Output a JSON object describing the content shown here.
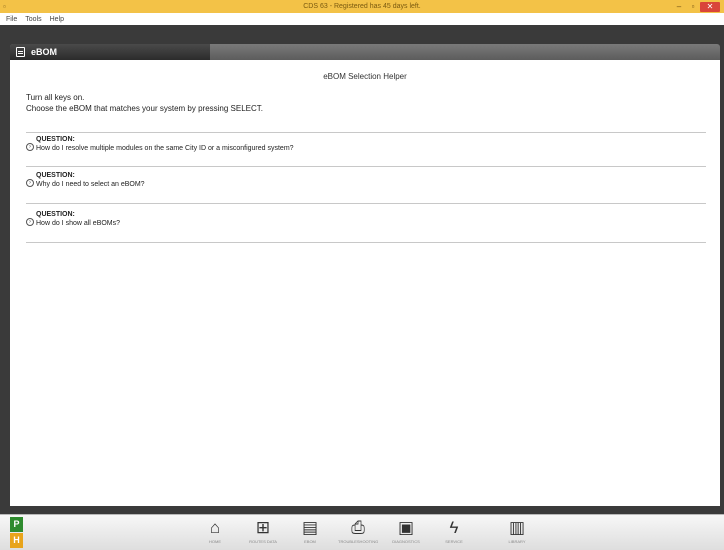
{
  "window": {
    "title": "CDS 63 - Registered has 45 days left.",
    "minimize": "–",
    "restore": "▫",
    "close": "✕"
  },
  "menu": {
    "items": [
      "File",
      "Tools",
      "Help"
    ]
  },
  "tab": {
    "label": "eBOM"
  },
  "helper": {
    "title": "eBOM Selection Helper",
    "line1": "Turn all keys on.",
    "line2": "Choose the eBOM that matches your system by pressing SELECT."
  },
  "questions": [
    {
      "label": "QUESTION:",
      "text": "How do I resolve multiple modules on the same City ID or a misconfigured system?",
      "icon": "expand-circle-icon"
    },
    {
      "label": "QUESTION:",
      "text": "Why do I need to select an eBOM?",
      "icon": "expand-circle-icon"
    },
    {
      "label": "QUESTION:",
      "text": "How do I show all eBOMs?",
      "icon": "expand-circle-icon"
    }
  ],
  "status": {
    "p": "P",
    "h": "H"
  },
  "nav": [
    {
      "label": "HOME",
      "icon": "home-icon",
      "glyph": "⌂"
    },
    {
      "label": "ROUTES DATA",
      "icon": "network-icon",
      "glyph": "⊞"
    },
    {
      "label": "EBOM",
      "icon": "document-icon",
      "glyph": "▤"
    },
    {
      "label": "TROUBLESHOOTING",
      "icon": "printer-icon",
      "glyph": "⎙"
    },
    {
      "label": "DIAGNOSTICS",
      "icon": "monitor-icon",
      "glyph": "▣"
    },
    {
      "label": "SERVICE",
      "icon": "lightning-icon",
      "glyph": "ϟ"
    },
    {
      "label": "LIBRARY",
      "icon": "book-icon",
      "glyph": "▥"
    }
  ]
}
